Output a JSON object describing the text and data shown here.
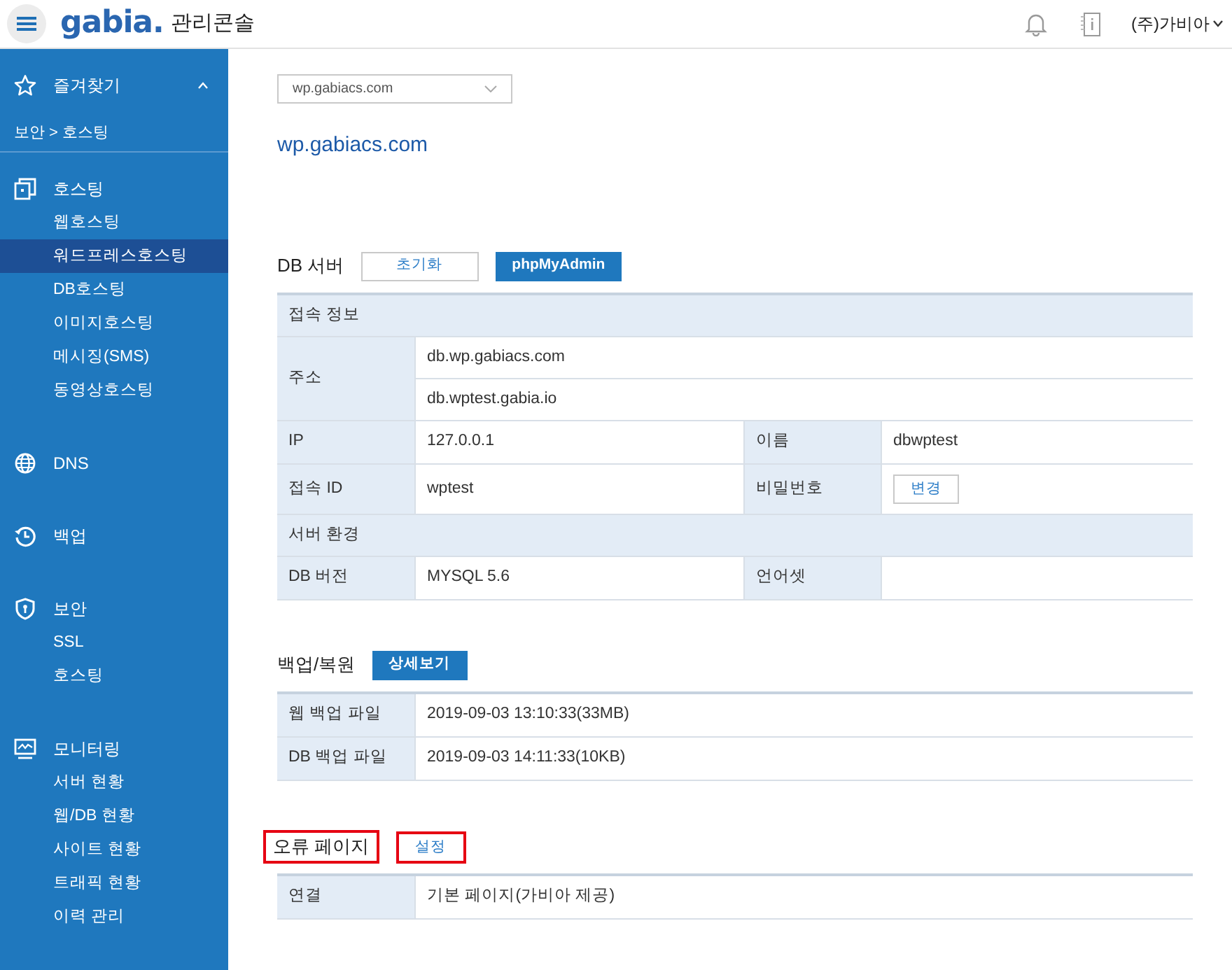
{
  "header": {
    "logo": "gabia.",
    "product": "관리콘솔",
    "user": "(주)가비아"
  },
  "sidebar": {
    "favorites": {
      "label": "즐겨찾기",
      "expanded": true
    },
    "breadcrumb": "보안 > 호스팅",
    "groups": [
      {
        "label": "호스팅",
        "items": [
          {
            "label": "웹호스팅",
            "selected": false
          },
          {
            "label": "워드프레스호스팅",
            "selected": true
          },
          {
            "label": "DB호스팅",
            "selected": false
          },
          {
            "label": "이미지호스팅",
            "selected": false
          },
          {
            "label": "메시징(SMS)",
            "selected": false
          },
          {
            "label": "동영상호스팅",
            "selected": false
          }
        ]
      },
      {
        "label": "DNS"
      },
      {
        "label": "백업"
      },
      {
        "label": "보안",
        "items": [
          {
            "label": "SSL",
            "selected": false
          },
          {
            "label": "호스팅",
            "selected": false
          }
        ]
      },
      {
        "label": "모니터링",
        "items": [
          {
            "label": "서버 현황",
            "selected": false
          },
          {
            "label": "웹/DB 현황",
            "selected": false
          },
          {
            "label": "사이트 현황",
            "selected": false
          },
          {
            "label": "트래픽 현황",
            "selected": false
          },
          {
            "label": "이력 관리",
            "selected": false
          }
        ]
      }
    ]
  },
  "domain_select": {
    "value": "wp.gabiacs.com"
  },
  "site_title": "wp.gabiacs.com",
  "db_server": {
    "title": "DB 서버",
    "buttons": [
      {
        "label": "초기화",
        "kind": "outline"
      },
      {
        "label": "phpMyAdmin",
        "kind": "primary"
      }
    ],
    "rows": [
      {
        "kind": "section",
        "label": "접속 정보"
      },
      {
        "kind": "multi",
        "label": "주소",
        "values": [
          "db.wp.gabiacs.com",
          "db.wptest.gabia.io"
        ]
      },
      {
        "kind": "pair",
        "cells": [
          {
            "label": "IP",
            "value": "127.0.0.1"
          },
          {
            "label": "이름",
            "value": "dbwptest"
          }
        ]
      },
      {
        "kind": "pair",
        "cells": [
          {
            "label": "접속 ID",
            "value": "wptest"
          },
          {
            "label": "비밀번호",
            "button": "변경"
          }
        ]
      },
      {
        "kind": "section",
        "label": "서버 환경"
      },
      {
        "kind": "pair",
        "cells": [
          {
            "label": "DB 버전",
            "value": "MYSQL 5.6"
          },
          {
            "label": "언어셋"
          }
        ]
      }
    ]
  },
  "backup": {
    "title": "백업/복원",
    "button": {
      "label": "상세보기",
      "kind": "primary"
    },
    "rows": [
      {
        "label": "웹 백업 파일",
        "value": "2019-09-03 13:10:33(33MB)"
      },
      {
        "label": "DB 백업 파일",
        "value": "2019-09-03 14:11:33(10KB)"
      }
    ]
  },
  "error_page": {
    "title": "오류 페이지",
    "highlighted": true,
    "button": {
      "label": "설정",
      "kind": "outline",
      "highlighted": true
    },
    "rows": [
      {
        "label": "연결",
        "value": "기본 페이지(가비아 제공)"
      }
    ]
  }
}
